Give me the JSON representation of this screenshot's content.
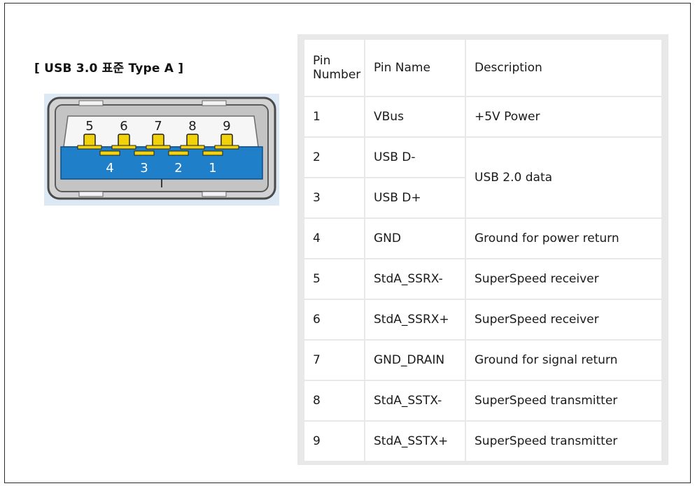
{
  "heading": "[ USB 3.0 표준 Type A ]",
  "connector": {
    "top_pins": [
      "5",
      "6",
      "7",
      "8",
      "9"
    ],
    "bottom_pins": [
      "4",
      "3",
      "2",
      "1"
    ],
    "colors": {
      "insulator": "#1f7fc8",
      "pin": "#f2d20a",
      "shell": "#5b5b5b",
      "background": "#dce8f4"
    }
  },
  "table": {
    "headers": {
      "pin_number": "Pin Number",
      "pin_name": "Pin Name",
      "description": "Description"
    },
    "rows": [
      {
        "number": "1",
        "name": "VBus",
        "description": "+5V Power"
      },
      {
        "number": "2",
        "name": "USB D-",
        "description": "USB 2.0 data"
      },
      {
        "number": "3",
        "name": "USB D+",
        "description": ""
      },
      {
        "number": "4",
        "name": "GND",
        "description": "Ground for power return"
      },
      {
        "number": "5",
        "name": "StdA_SSRX-",
        "description": "SuperSpeed receiver"
      },
      {
        "number": "6",
        "name": "StdA_SSRX+",
        "description": "SuperSpeed receiver"
      },
      {
        "number": "7",
        "name": "GND_DRAIN",
        "description": "Ground for signal return"
      },
      {
        "number": "8",
        "name": "StdA_SSTX-",
        "description": "SuperSpeed transmitter"
      },
      {
        "number": "9",
        "name": "StdA_SSTX+",
        "description": "SuperSpeed transmitter"
      }
    ]
  }
}
